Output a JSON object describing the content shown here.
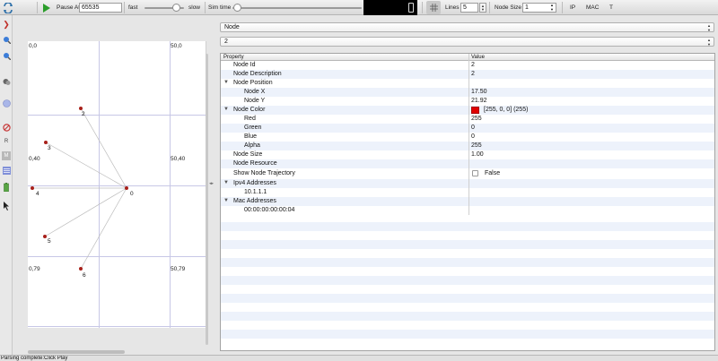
{
  "toolbar": {
    "pause_at_label": "Pause At",
    "pause_at_value": "65535",
    "fast_label": "fast",
    "slow_label": "slow",
    "sim_time_label": "Sim time",
    "lines_label": "Lines",
    "lines_value": "5",
    "node_size_label": "Node Size",
    "node_size_value": "1",
    "ip_label": "IP",
    "mac_label": "MAC",
    "t_label": "T",
    "accent_green": "#2a9d2a"
  },
  "canvas": {
    "corners": {
      "top_left": "0,0",
      "top_right": "50,0",
      "mid_left": "0,40",
      "mid_right": "50,40",
      "bottom_left": "0,79",
      "bottom_right": "50,79"
    },
    "nodes": [
      {
        "id": "0",
        "color": "#a8201a"
      },
      {
        "id": "2",
        "color": "#a8201a"
      },
      {
        "id": "3",
        "color": "#a8201a"
      },
      {
        "id": "4",
        "color": "#a8201a"
      },
      {
        "id": "5",
        "color": "#a8201a"
      },
      {
        "id": "6",
        "color": "#a8201a"
      }
    ]
  },
  "panel": {
    "type_select": "Node",
    "id_select": "2",
    "header_property": "Property",
    "header_value": "Value",
    "rows": [
      {
        "key": "Node Id",
        "value": "2"
      },
      {
        "key": "Node Description",
        "value": "2"
      },
      {
        "key": "Node Position",
        "value": ""
      },
      {
        "key": "Node X",
        "value": "17.50"
      },
      {
        "key": "Node Y",
        "value": "21.92"
      },
      {
        "key": "Node Color",
        "value": "[255, 0, 0] (255)"
      },
      {
        "key": "Red",
        "value": "255"
      },
      {
        "key": "Green",
        "value": "0"
      },
      {
        "key": "Blue",
        "value": "0"
      },
      {
        "key": "Alpha",
        "value": "255"
      },
      {
        "key": "Node Size",
        "value": "1.00"
      },
      {
        "key": "Node Resource",
        "value": ""
      },
      {
        "key": "Show Node Trajectory",
        "value": "False"
      },
      {
        "key": "Ipv4 Addresses",
        "value": ""
      },
      {
        "key": "10.1.1.1",
        "value": ""
      },
      {
        "key": "Mac Addresses",
        "value": ""
      },
      {
        "key": "00:00:00:00:00:04",
        "value": ""
      }
    ],
    "node_color_hex": "#e00000"
  },
  "status": {
    "text": "Parsing complete:Click Play"
  }
}
